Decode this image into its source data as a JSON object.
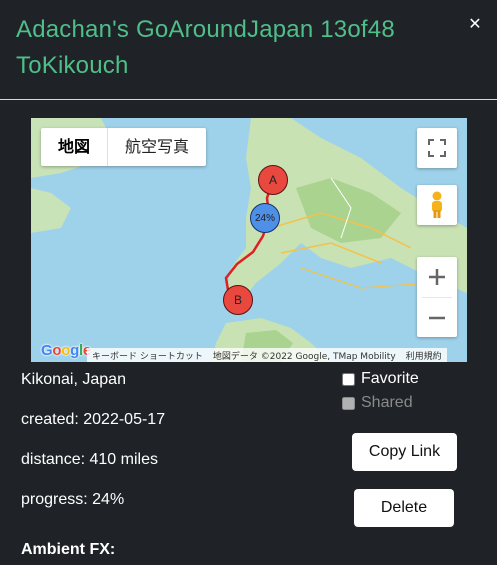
{
  "header": {
    "title": "Adachan's GoAroundJapan 13of48 ToKikouch",
    "close_label": "✕"
  },
  "map": {
    "map_type_options": [
      "地図",
      "航空写真"
    ],
    "marker_start": "A",
    "marker_end": "B",
    "marker_progress": "24%",
    "google_logo": "Google",
    "attribution": [
      "キーボード ショートカット",
      "地図データ ©2022 Google, TMap Mobility",
      "利用規約"
    ]
  },
  "details": {
    "location": "Kikonai, Japan",
    "created": "created: 2022-05-17",
    "distance": "distance: 410 miles",
    "progress": "progress: 24%",
    "ambient": "Ambient FX:"
  },
  "options": {
    "favorite_label": "Favorite",
    "shared_label": "Shared",
    "copy_link_label": "Copy Link",
    "delete_label": "Delete"
  },
  "colors": {
    "background": "#1f2227",
    "title": "#4fbf8a",
    "marker": "#e8483e",
    "progress_marker": "#4e8fe8",
    "route": "#e02020"
  }
}
